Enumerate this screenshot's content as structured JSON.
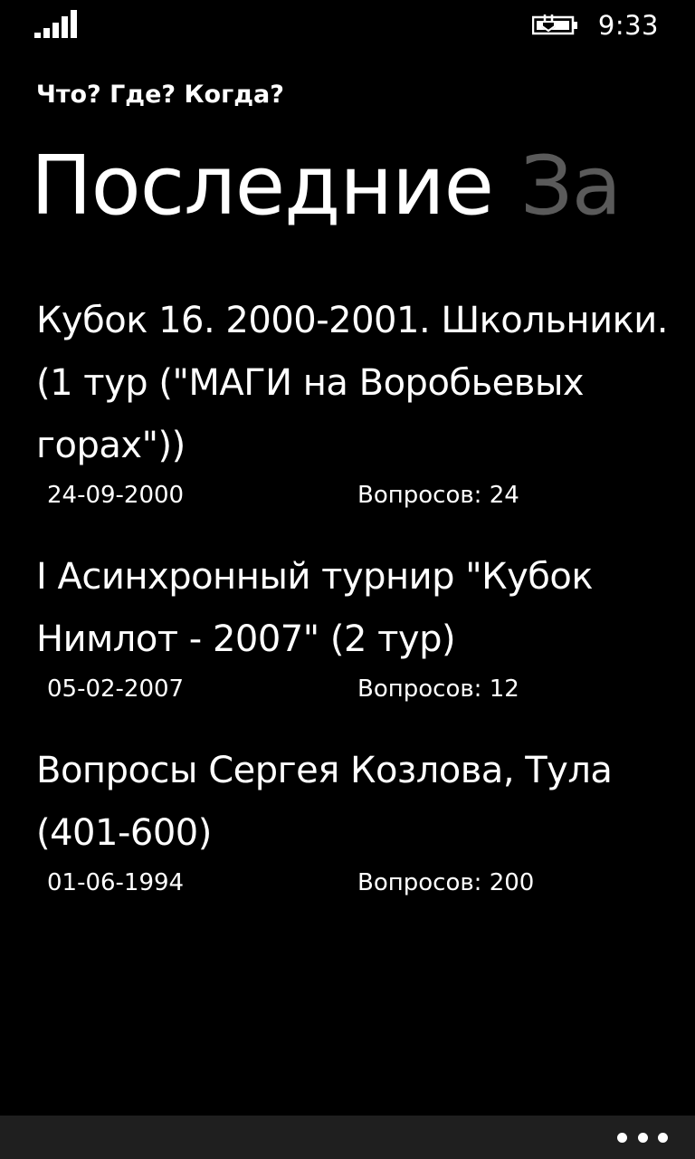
{
  "status_bar": {
    "time": "9:33",
    "signal_icon": "signal-strength-icon",
    "battery_icon": "battery-charging-icon"
  },
  "app": {
    "title": "Что? Где? Когда?"
  },
  "pivot": {
    "active": "Последние",
    "next": "За"
  },
  "list": {
    "items": [
      {
        "title": "Кубок 16. 2000-2001. Школьники. (1 тур (\"МАГИ на Воробьевых горах\"))",
        "date": "24-09-2000",
        "count": "Вопросов: 24"
      },
      {
        "title": "I Асинхронный турнир \"Кубок Нимлот - 2007\" (2 тур)",
        "date": "05-02-2007",
        "count": "Вопросов: 12"
      },
      {
        "title": "Вопросы Сергея Козлова, Тула (401-600)",
        "date": "01-06-1994",
        "count": "Вопросов: 200"
      }
    ]
  },
  "app_bar": {
    "more_icon": "ellipsis-icon"
  }
}
